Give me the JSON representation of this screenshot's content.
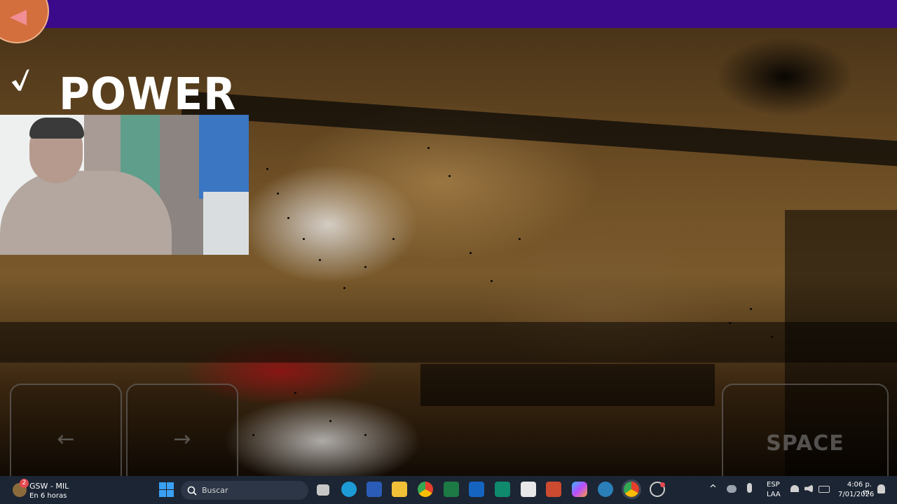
{
  "game": {
    "title_text": "POWER",
    "keys": [
      {
        "name": "left-arrow-key",
        "label": "←"
      },
      {
        "name": "right-arrow-key",
        "label": "→"
      },
      {
        "name": "space-key",
        "label": "SPACE"
      }
    ],
    "colors": {
      "topbar": "#3b0a8a",
      "back_button": "#d36f3c",
      "logo": "#ffffff"
    }
  },
  "taskbar": {
    "weather_title": "GSW - MIL",
    "weather_sub": "En 6 horas",
    "weather_badge": "2",
    "search_placeholder": "Buscar",
    "lang_top": "ESP",
    "lang_bottom": "LAA",
    "time": "4:06 p. m.",
    "date": "7/01/2026",
    "icons": [
      "start-icon",
      "search-icon",
      "task-view-icon",
      "edge-icon",
      "word-icon",
      "file-explorer-icon",
      "chrome-icon",
      "excel-icon",
      "outlook-icon",
      "publisher-icon",
      "store-icon",
      "powerpoint-icon",
      "copilot-icon",
      "clock-sync-icon",
      "chrome-profile-icon",
      "app-icon"
    ]
  }
}
